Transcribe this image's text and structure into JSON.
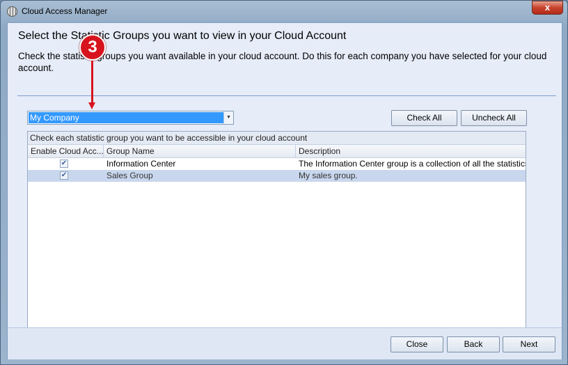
{
  "window": {
    "title": "Cloud Access Manager",
    "close_label": "x"
  },
  "header": {
    "title": "Select the Statistic Groups you want to view in your Cloud Account",
    "description": "Check the statistic groups you want available in your cloud account. Do this for each company you have selected for your cloud account."
  },
  "company_select": {
    "value": "My Company"
  },
  "toolbar": {
    "check_all": "Check All",
    "uncheck_all": "Uncheck All"
  },
  "grid": {
    "caption": "Check each statistic group you want to be accessible in your cloud account",
    "columns": [
      "Enable Cloud Acc...",
      "Group Name",
      "Description"
    ],
    "rows": [
      {
        "enabled": true,
        "name": "Information Center",
        "description": "The Information Center group is a collection of all the statistics with..."
      },
      {
        "enabled": true,
        "name": "Sales Group",
        "description": "My sales group."
      }
    ]
  },
  "footer": {
    "close": "Close",
    "back": "Back",
    "next": "Next"
  },
  "annotation": {
    "step": "3",
    "color": "#d7141e"
  }
}
